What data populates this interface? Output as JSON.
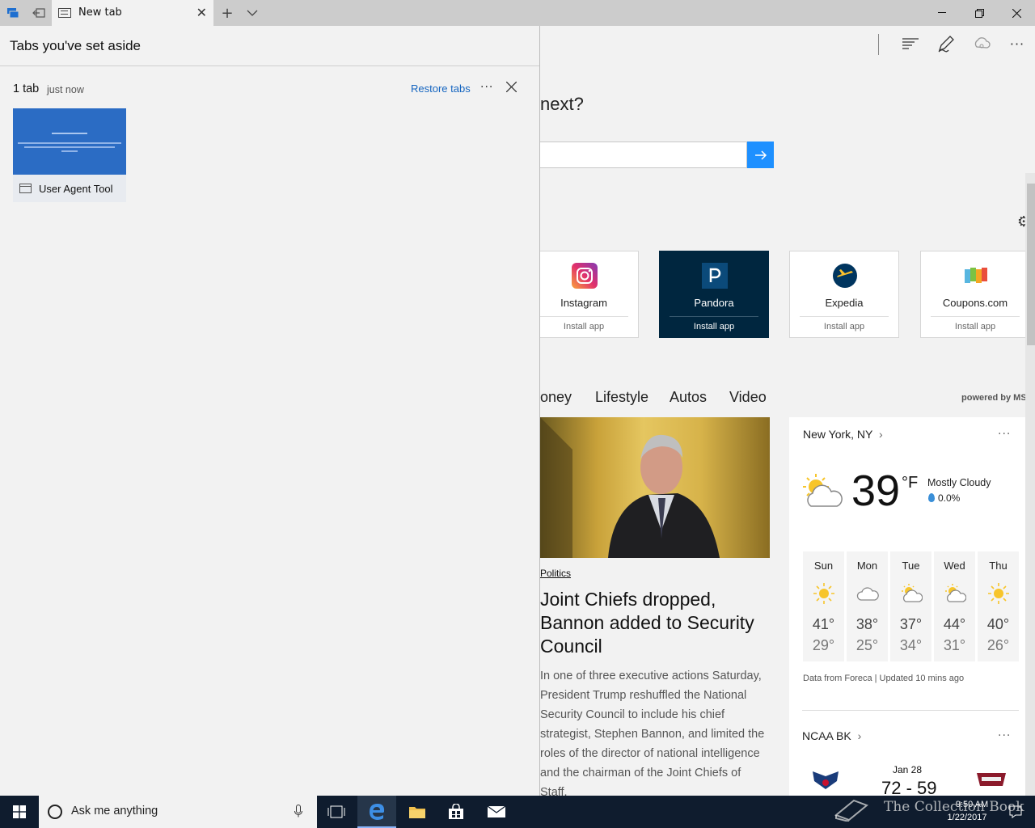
{
  "browser": {
    "tab_title": "New tab",
    "tab_icon": "newtab-page-icon",
    "toolbar_icons": [
      "hub-icon",
      "web-note-pen-icon",
      "share-icon",
      "more-icon"
    ]
  },
  "set_aside_panel": {
    "title": "Tabs you've set aside",
    "group": {
      "count": "1 tab",
      "time": "just now",
      "restore_label": "Restore tabs",
      "more_label": "···",
      "tabs": [
        {
          "title": "User Agent Tool"
        }
      ]
    }
  },
  "new_tab_page": {
    "prompt_fragment": "next?",
    "apps": [
      {
        "name": "Instagram",
        "action": "Install app",
        "theme": "light"
      },
      {
        "name": "Pandora",
        "action": "Install app",
        "theme": "dark"
      },
      {
        "name": "Expedia",
        "action": "Install app",
        "theme": "light"
      },
      {
        "name": "Coupons.com",
        "action": "Install app",
        "theme": "light"
      }
    ],
    "nav": [
      "oney",
      "Lifestyle",
      "Autos",
      "Video"
    ],
    "powered_by": "powered by MS",
    "news": {
      "category": "Politics",
      "headline": "Joint Chiefs dropped, Bannon added to Security Council",
      "summary": "In one of three executive actions Saturday, President Trump reshuffled the National Security Council to include his chief strategist, Stephen Bannon, and limited the roles of the director of national intelligence and the chairman of the Joint Chiefs of Staff."
    },
    "weather": {
      "location": "New York, NY",
      "chevron": "›",
      "temp": "39",
      "unit": "°F",
      "condition": "Mostly Cloudy",
      "precip": "0.0%",
      "forecast": [
        {
          "day": "Sun",
          "hi": "41°",
          "lo": "29°",
          "icon": "sunny"
        },
        {
          "day": "Mon",
          "hi": "38°",
          "lo": "25°",
          "icon": "cloudy"
        },
        {
          "day": "Tue",
          "hi": "37°",
          "lo": "34°",
          "icon": "partly-cloudy"
        },
        {
          "day": "Wed",
          "hi": "44°",
          "lo": "31°",
          "icon": "partly-cloudy"
        },
        {
          "day": "Thu",
          "hi": "40°",
          "lo": "26°",
          "icon": "sunny"
        }
      ],
      "source": "Data from Foreca | Updated 10 mins ago"
    },
    "sports": {
      "title": "NCAA BK",
      "date": "Jan 28",
      "score": "72 - 59"
    }
  },
  "taskbar": {
    "search_placeholder": "Ask me anything",
    "time": "9:50 AM",
    "date": "1/22/2017"
  },
  "watermark": "The Collection Book",
  "colors": {
    "accent": "#1e90ff",
    "link": "#1565c0",
    "pandora": "#00263f",
    "taskbar": "#0f1c2e"
  }
}
